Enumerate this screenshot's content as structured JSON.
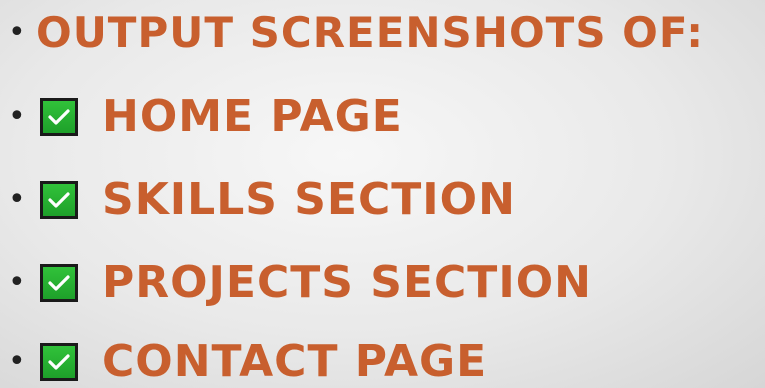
{
  "heading": "OUTPUT SCREENSHOTS OF:",
  "items": [
    {
      "label": "HOME PAGE",
      "checked": true
    },
    {
      "label": "SKILLS SECTION",
      "checked": true
    },
    {
      "label": "PROJECTS SECTION",
      "checked": true
    },
    {
      "label": "CONTACT PAGE",
      "checked": true
    }
  ],
  "colors": {
    "text_accent": "#c85f2e",
    "check_green": "#27b332",
    "bullet": "#222222"
  },
  "icons": {
    "bullet": "bullet-dot-icon",
    "check": "checkbox-checked-icon"
  }
}
